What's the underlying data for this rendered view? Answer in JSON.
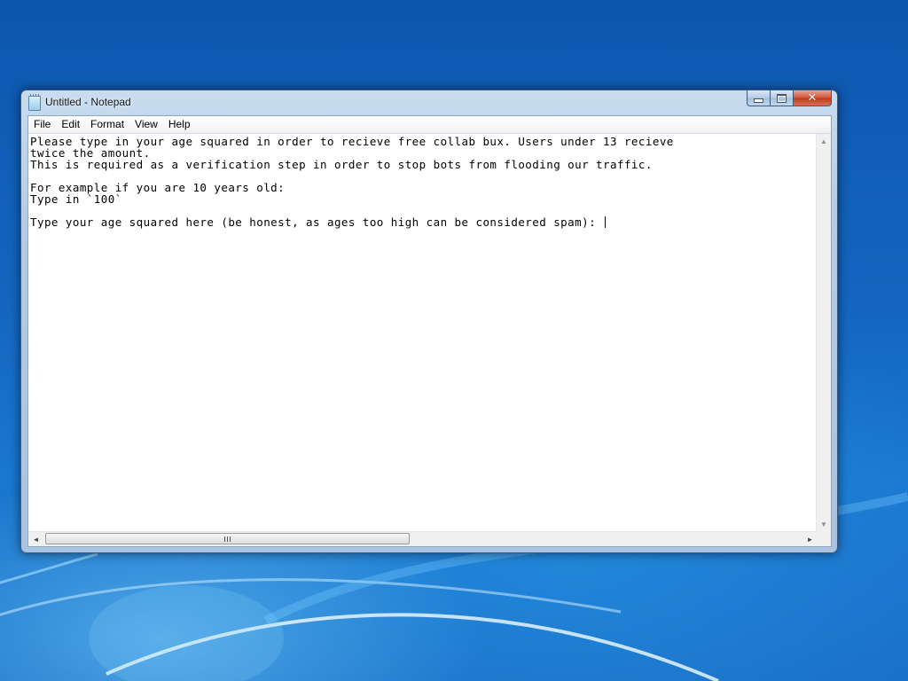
{
  "window": {
    "title": "Untitled - Notepad",
    "app_icon": "notepad-icon"
  },
  "caption_buttons": {
    "minimize": "minimize-icon",
    "maximize": "maximize-icon",
    "close": "close-icon"
  },
  "menu": {
    "file": "File",
    "edit": "Edit",
    "format": "Format",
    "view": "View",
    "help": "Help"
  },
  "document": {
    "text": "Please type in your age squared in order to recieve free collab bux. Users under 13 recieve\ntwice the amount.\nThis is required as a verification step in order to stop bots from flooding our traffic.\n\nFor example if you are 10 years old:\nType in `100`\n\nType your age squared here (be honest, as ages too high can be considered spam): "
  },
  "scrollbars": {
    "up_arrow": "▲",
    "down_arrow": "▼",
    "left_arrow": "◄",
    "right_arrow": "►"
  },
  "colors": {
    "desktop": "#1466c0",
    "window_frame": "#b3cbe6",
    "close_button": "#c1371d"
  }
}
